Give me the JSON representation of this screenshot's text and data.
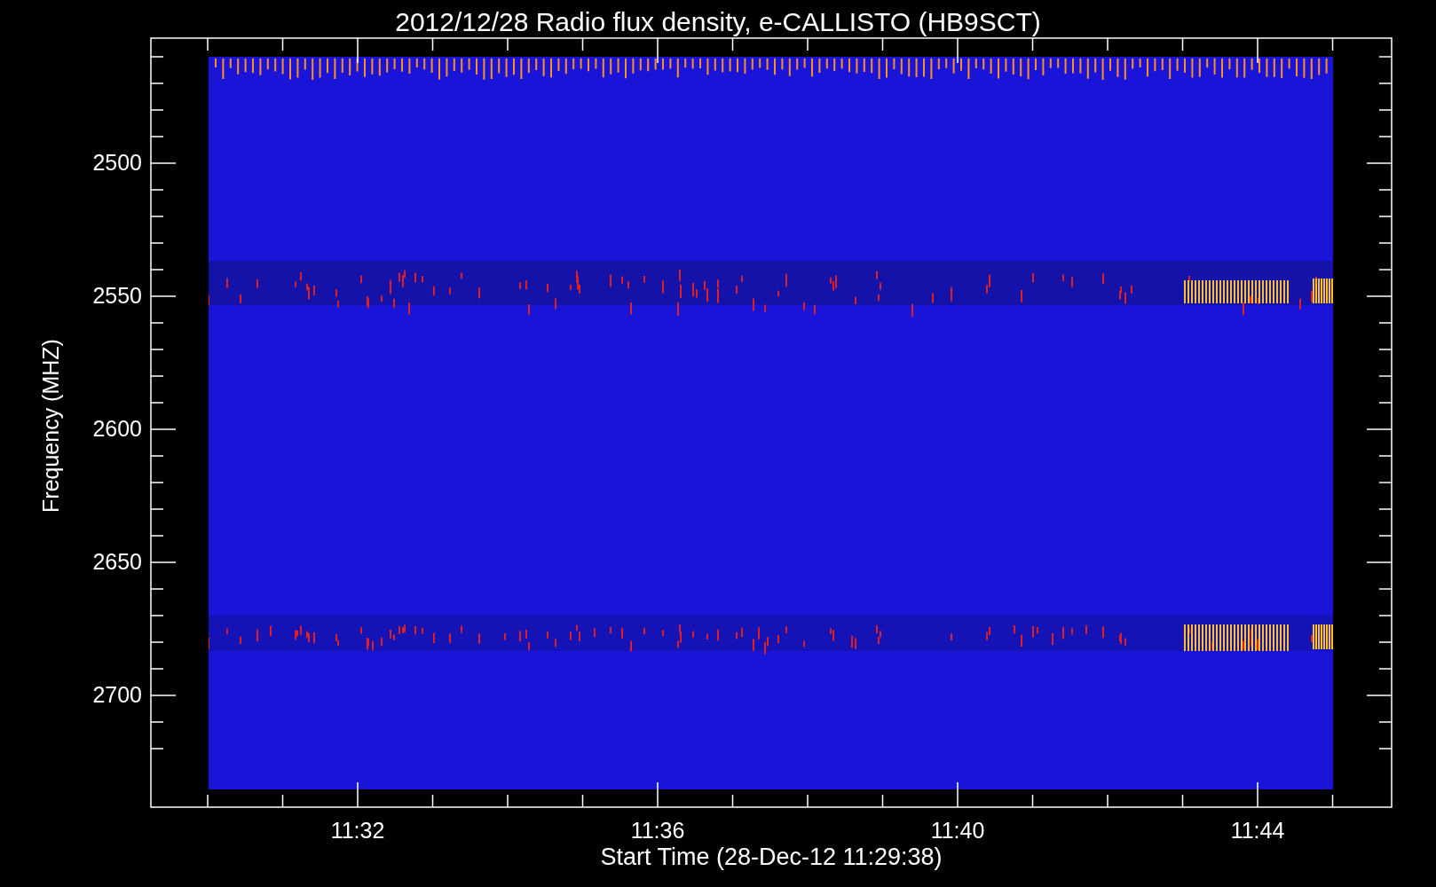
{
  "title": "2012/12/28  Radio flux density, e-CALLISTO (HB9SCT)",
  "y_axis": {
    "label": "Frequency (MHZ)",
    "ticks": [
      "2500",
      "2550",
      "2600",
      "2650",
      "2700"
    ]
  },
  "x_axis": {
    "label": "Start Time (28-Dec-12 11:29:38)",
    "ticks": [
      "11:32",
      "11:36",
      "11:40",
      "11:44"
    ]
  }
}
